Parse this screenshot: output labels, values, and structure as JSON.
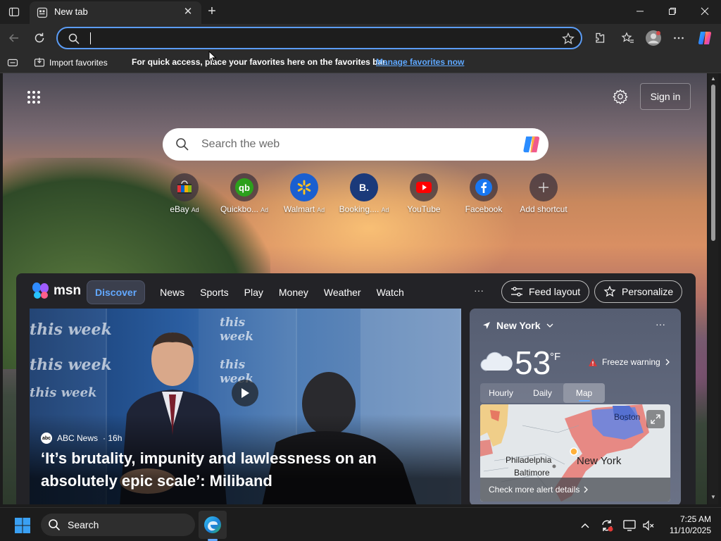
{
  "browser": {
    "tab_title": "New tab",
    "address_value": "",
    "favorites_bar": {
      "import_label": "Import favorites",
      "message": "For quick access, place your favorites here on the favorites bar.",
      "manage_link": "Manage favorites now"
    }
  },
  "newtab": {
    "sign_in_label": "Sign in",
    "search_placeholder": "Search the web",
    "shortcuts": [
      {
        "label": "eBay",
        "ad": "Ad",
        "icon": "ebay-icon"
      },
      {
        "label": "Quickbo...",
        "ad": "Ad",
        "icon": "quickbooks-icon"
      },
      {
        "label": "Walmart",
        "ad": "Ad",
        "icon": "walmart-icon"
      },
      {
        "label": "Booking....",
        "ad": "Ad",
        "icon": "booking-icon"
      },
      {
        "label": "YouTube",
        "ad": "",
        "icon": "youtube-icon"
      },
      {
        "label": "Facebook",
        "ad": "",
        "icon": "facebook-icon"
      },
      {
        "label": "Add shortcut",
        "ad": "",
        "icon": "plus-icon"
      }
    ]
  },
  "feed": {
    "logo_text": "msn",
    "nav": [
      "Discover",
      "News",
      "Sports",
      "Play",
      "Money",
      "Weather",
      "Watch"
    ],
    "more": "···",
    "feed_layout_label": "Feed layout",
    "personalize_label": "Personalize",
    "hero": {
      "source": "ABC News",
      "age": "· 16h",
      "headline": "‘It’s brutality, impunity and lawlessness on an absolutely epic scale’: Miliband",
      "backdrop_word": "this week"
    },
    "weather": {
      "location": "New York",
      "temperature": "53",
      "unit": "°F",
      "alert": "Freeze warning",
      "tabs": [
        "Hourly",
        "Daily",
        "Map"
      ],
      "active_tab": "Map",
      "map_labels": {
        "boston": "Boston",
        "philadelphia": "Philadelphia",
        "baltimore": "Baltimore",
        "new_york": "New York"
      },
      "alert_link": "Check more alert details"
    }
  },
  "taskbar": {
    "search_label": "Search",
    "time": "7:25 AM",
    "date": "11/10/2025"
  },
  "colors": {
    "accent": "#62a8ff",
    "address_border": "#5b9cf5",
    "link": "#5ea8ff"
  }
}
